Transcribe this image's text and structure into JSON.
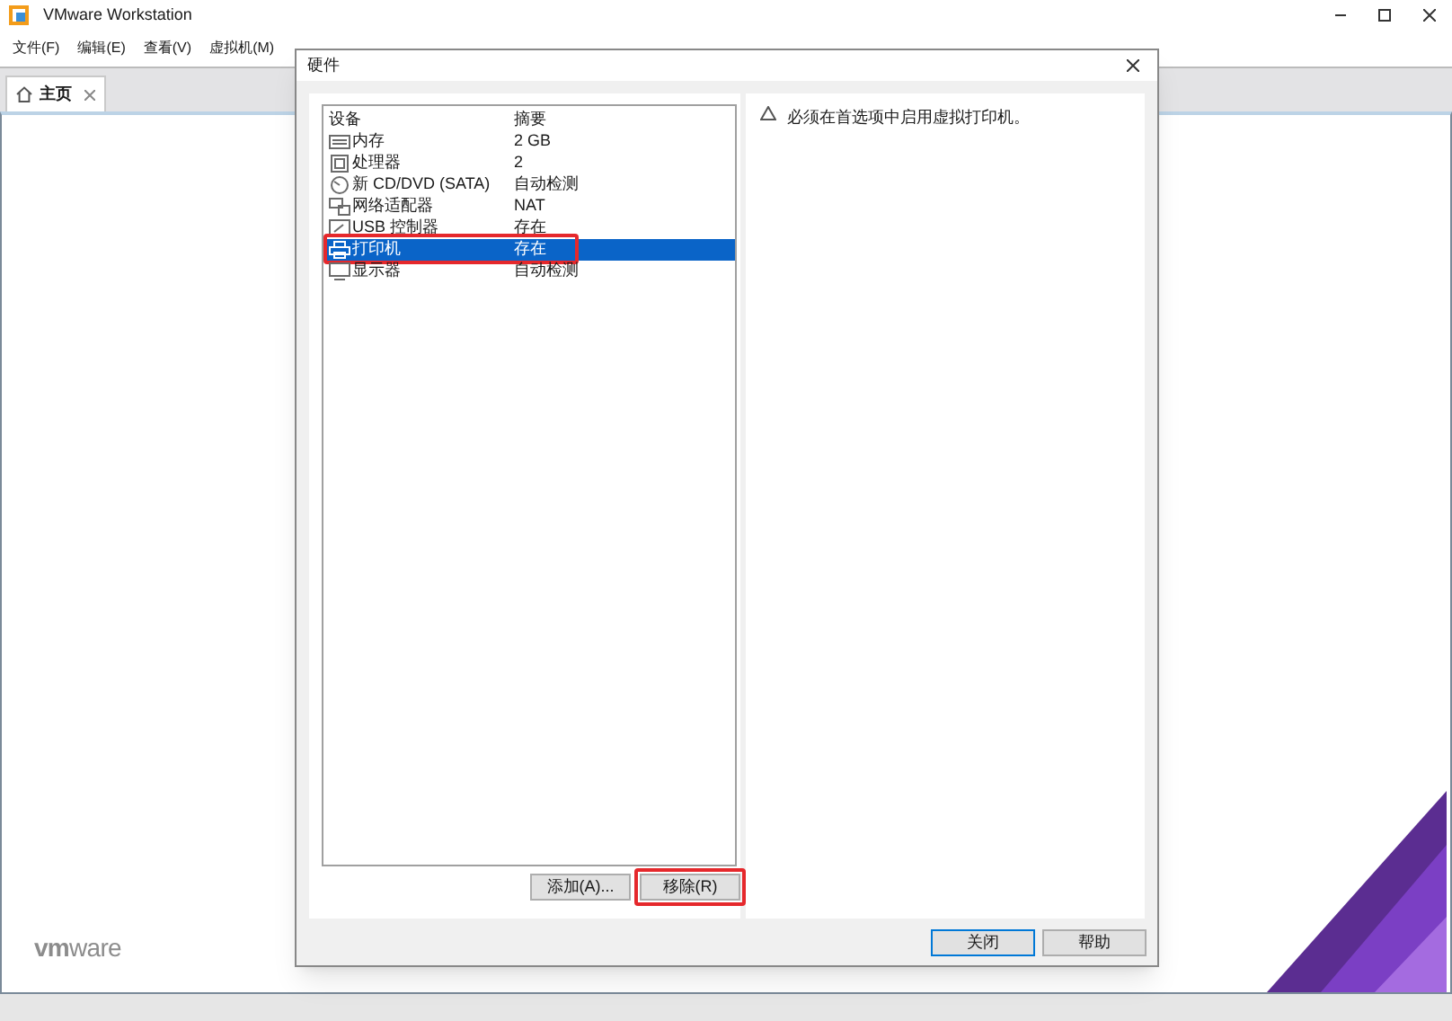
{
  "window": {
    "title": "VMware Workstation"
  },
  "menu": [
    "文件(F)",
    "编辑(E)",
    "查看(V)",
    "虚拟机(M)"
  ],
  "tabs": [
    {
      "label": "主页",
      "selected": true
    }
  ],
  "logo": "vmware",
  "dialog": {
    "title": "硬件",
    "columns": [
      "设备",
      "摘要"
    ],
    "devices": [
      {
        "kind": "memory",
        "name": "内存",
        "summary": "2 GB",
        "selected": false
      },
      {
        "kind": "cpu",
        "name": "处理器",
        "summary": "2",
        "selected": false
      },
      {
        "kind": "disc",
        "name": "新 CD/DVD (SATA)",
        "summary": "自动检测",
        "selected": false
      },
      {
        "kind": "network",
        "name": "网络适配器",
        "summary": "NAT",
        "selected": false
      },
      {
        "kind": "usb",
        "name": "USB 控制器",
        "summary": "存在",
        "selected": false
      },
      {
        "kind": "printer",
        "name": "打印机",
        "summary": "存在",
        "selected": true
      },
      {
        "kind": "display",
        "name": "显示器",
        "summary": "自动检测",
        "selected": false
      }
    ],
    "message": "必须在首选项中启用虚拟打印机。",
    "list_buttons": [
      "添加(A)...",
      "移除(R)"
    ],
    "footer_buttons": [
      {
        "label": "关闭",
        "default": true
      },
      {
        "label": "帮助",
        "default": false
      }
    ]
  }
}
